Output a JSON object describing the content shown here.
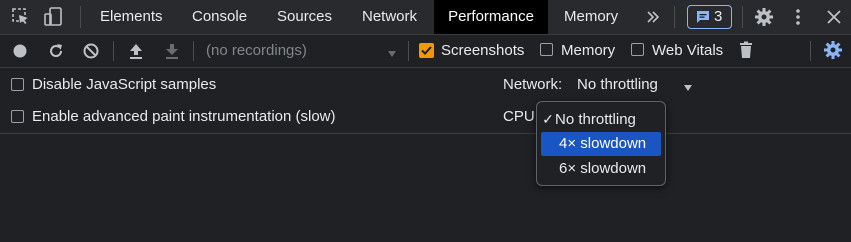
{
  "tabs": {
    "items": [
      {
        "label": "Elements"
      },
      {
        "label": "Console"
      },
      {
        "label": "Sources"
      },
      {
        "label": "Network"
      },
      {
        "label": "Performance"
      },
      {
        "label": "Memory"
      }
    ],
    "active": "Performance",
    "more_icon": "double-chevron-right-icon",
    "issues_count": "3"
  },
  "toolbar": {
    "recordings_placeholder": "(no recordings)",
    "screenshots_label": "Screenshots",
    "screenshots_checked": true,
    "memory_label": "Memory",
    "memory_checked": false,
    "web_vitals_label": "Web Vitals",
    "web_vitals_checked": false
  },
  "settings": {
    "disable_js_samples_label": "Disable JavaScript samples",
    "enable_paint_label": "Enable advanced paint instrumentation (slow)",
    "network_label": "Network:",
    "network_value": "No throttling",
    "cpu_label": "CPU:"
  },
  "cpu_dropdown": {
    "options": [
      "No throttling",
      "4× slowdown",
      "6× slowdown"
    ],
    "selected": "No throttling",
    "highlighted": "4× slowdown",
    "check_glyph": "✓"
  },
  "colors": {
    "accent_blue": "#8ab4f8",
    "checkbox_orange": "#f29900",
    "highlight": "#1a56c3",
    "background": "#202124"
  }
}
